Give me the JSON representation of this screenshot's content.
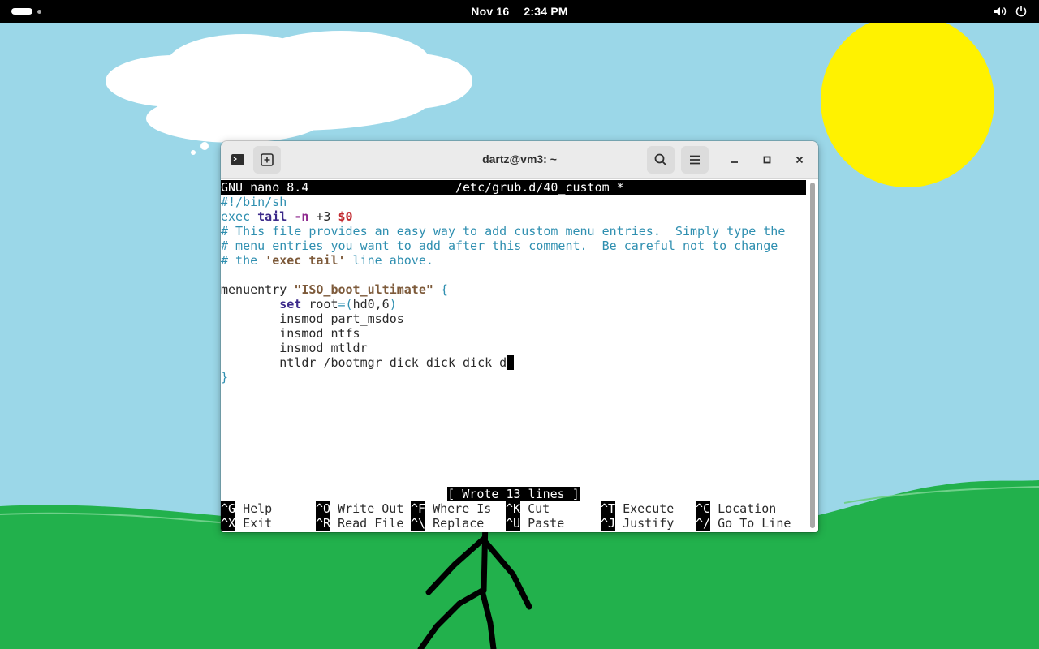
{
  "topbar": {
    "date": "Nov 16",
    "time": "2:34 PM",
    "icons": [
      "activities-indicator",
      "volume-icon",
      "power-icon"
    ]
  },
  "window": {
    "title": "dartz@vm3: ~",
    "buttons": [
      "terminal-icon",
      "new-tab-icon",
      "search-icon",
      "hamburger-menu-icon",
      "minimize-icon",
      "maximize-icon",
      "close-icon"
    ]
  },
  "nano": {
    "version": "GNU nano 8.4",
    "filename": "/etc/grub.d/40_custom *",
    "lines": {
      "l1": "#!/bin/sh",
      "l2_exec": "exec ",
      "l2_tail": "tail",
      "l2_opt": "-n",
      "l2_num": " +3 ",
      "l2_var": "$0",
      "l3": "# This file provides an easy way to add custom menu entries.  Simply type the",
      "l4": "# menu entries you want to add after this comment.  Be careful not to change",
      "l5_a": "# the ",
      "l5_b": "'exec tail'",
      "l5_c": " line above.",
      "l7_a": "menuentry ",
      "l7_b": "\"ISO_boot_ultimate\"",
      "l7_c": " {",
      "l8_a": "        ",
      "l8_b": "set",
      "l8_c": " root",
      "l8_d": "=(",
      "l8_e": "hd0,6",
      "l8_f": ")",
      "l9": "        insmod part_msdos",
      "l10": "        insmod ntfs",
      "l11": "        insmod mtldr",
      "l12": "        ntldr /bootmgr dick dick dick d",
      "l12_cursor": " ",
      "l13": "}"
    },
    "status": "[ Wrote 13 lines ]",
    "shortcuts": [
      {
        "key": "^G",
        "label": "Help"
      },
      {
        "key": "^O",
        "label": "Write Out"
      },
      {
        "key": "^F",
        "label": "Where Is"
      },
      {
        "key": "^K",
        "label": "Cut"
      },
      {
        "key": "^T",
        "label": "Execute"
      },
      {
        "key": "^C",
        "label": "Location"
      },
      {
        "key": "^X",
        "label": "Exit"
      },
      {
        "key": "^R",
        "label": "Read File"
      },
      {
        "key": "^\\",
        "label": "Replace"
      },
      {
        "key": "^U",
        "label": "Paste"
      },
      {
        "key": "^J",
        "label": "Justify"
      },
      {
        "key": "^/",
        "label": "Go To Line"
      }
    ]
  },
  "colors": {
    "sky": "#9bd7e8",
    "sun": "#fff200",
    "grass": "#22b14c",
    "terminal_bg": "#ffffff",
    "comment": "#2f8fb0"
  }
}
